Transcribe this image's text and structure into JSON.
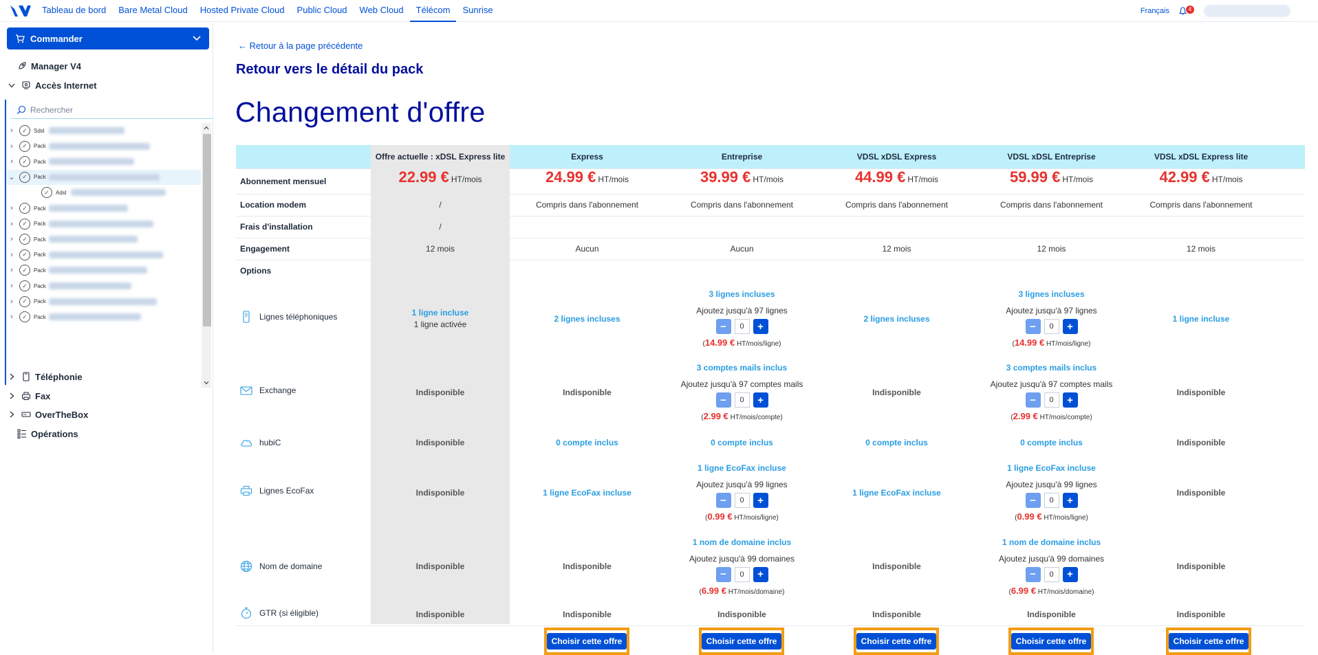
{
  "topnav": {
    "links": [
      "Tableau de bord",
      "Bare Metal Cloud",
      "Hosted Private Cloud",
      "Public Cloud",
      "Web Cloud",
      "Télécom",
      "Sunrise"
    ],
    "active_index": 5,
    "language": "Français",
    "notifications": "4"
  },
  "sidebar": {
    "order_button": "Commander",
    "manager": "Manager V4",
    "internet": "Accès Internet",
    "search_placeholder": "Rechercher",
    "tree_items": [
      {
        "type": "Sdsl",
        "selected": false,
        "expanded": false,
        "level": 0
      },
      {
        "type": "Pack",
        "selected": false,
        "expanded": false,
        "level": 0
      },
      {
        "type": "Pack",
        "selected": false,
        "expanded": false,
        "level": 0
      },
      {
        "type": "Pack",
        "selected": true,
        "expanded": true,
        "level": 0
      },
      {
        "type": "Adsl",
        "selected": false,
        "expanded": false,
        "level": 1
      },
      {
        "type": "Pack",
        "selected": false,
        "expanded": false,
        "level": 0
      },
      {
        "type": "Pack",
        "selected": false,
        "expanded": false,
        "level": 0
      },
      {
        "type": "Pack",
        "selected": false,
        "expanded": false,
        "level": 0
      },
      {
        "type": "Pack",
        "selected": false,
        "expanded": false,
        "level": 0
      },
      {
        "type": "Pack",
        "selected": false,
        "expanded": false,
        "level": 0
      },
      {
        "type": "Pack",
        "selected": false,
        "expanded": false,
        "level": 0
      },
      {
        "type": "Pack",
        "selected": false,
        "expanded": false,
        "level": 0
      },
      {
        "type": "Pack",
        "selected": false,
        "expanded": false,
        "level": 0
      }
    ],
    "sections": [
      "Téléphonie",
      "Fax",
      "OverTheBox",
      "Opérations"
    ]
  },
  "main": {
    "back_link": "← Retour à la page précédente",
    "pack_title": "Retour vers le détail du pack",
    "page_title": "Changement d'offre",
    "row_labels": [
      "Abonnement mensuel",
      "Location modem",
      "Frais d'installation",
      "Engagement",
      "Options"
    ],
    "offers": [
      {
        "name": "Offre actuelle : xDSL Express lite",
        "price": "22.99 €",
        "unit": "HT/mois",
        "modem": "/",
        "install": "/",
        "engagement": "12 mois"
      },
      {
        "name": "Express",
        "price": "24.99 €",
        "unit": "HT/mois",
        "modem": "Compris dans l'abonnement",
        "install": "",
        "engagement": "Aucun"
      },
      {
        "name": "Entreprise",
        "price": "39.99 €",
        "unit": "HT/mois",
        "modem": "Compris dans l'abonnement",
        "install": "",
        "engagement": "Aucun"
      },
      {
        "name": "VDSL xDSL Express",
        "price": "44.99 €",
        "unit": "HT/mois",
        "modem": "Compris dans l'abonnement",
        "install": "",
        "engagement": "12 mois"
      },
      {
        "name": "VDSL xDSL Entreprise",
        "price": "59.99 €",
        "unit": "HT/mois",
        "modem": "Compris dans l'abonnement",
        "install": "",
        "engagement": "12 mois"
      },
      {
        "name": "VDSL xDSL Express lite",
        "price": "42.99 €",
        "unit": "HT/mois",
        "modem": "Compris dans l'abonnement",
        "install": "",
        "engagement": "12 mois"
      }
    ],
    "options": {
      "lines": {
        "label": "Lignes téléphoniques",
        "current_top": "1 ligne incluse",
        "current_sub": "1 ligne activée",
        "express": "2 lignes incluses",
        "ent_included": "3 lignes incluses",
        "ent_add": "Ajoutez jusqu'à 97 lignes",
        "ent_price": "14.99 €",
        "ent_unit": "HT/mois/ligne",
        "vdsl_express": "2 lignes incluses",
        "vdsl_ent_included": "3 lignes incluses",
        "vdsl_ent_add": "Ajoutez jusqu'à 97 lignes",
        "vdsl_ent_price": "14.99 €",
        "vdsl_ent_unit": "HT/mois/ligne",
        "vdsl_lite": "1 ligne incluse",
        "value": "0"
      },
      "exchange": {
        "label": "Exchange",
        "current": "Indisponible",
        "express": "Indisponible",
        "ent_included": "3 comptes mails inclus",
        "ent_add": "Ajoutez jusqu'à 97 comptes mails",
        "ent_price": "2.99 €",
        "ent_unit": "HT/mois/compte",
        "vdsl_express": "Indisponible",
        "vdsl_ent_included": "3 comptes mails inclus",
        "vdsl_ent_add": "Ajoutez jusqu'à 97 comptes mails",
        "vdsl_ent_price": "2.99 €",
        "vdsl_ent_unit": "HT/mois/compte",
        "vdsl_lite": "Indisponible",
        "value": "0"
      },
      "hubic": {
        "label": "hubiC",
        "current": "Indisponible",
        "express": "0 compte inclus",
        "ent": "0 compte inclus",
        "vdsl_express": "0 compte inclus",
        "vdsl_ent": "0 compte inclus",
        "vdsl_lite": "Indisponible"
      },
      "ecofax": {
        "label": "Lignes EcoFax",
        "current": "Indisponible",
        "express": "1 ligne EcoFax incluse",
        "ent_included": "1 ligne EcoFax incluse",
        "ent_add": "Ajoutez jusqu'à 99 lignes",
        "ent_price": "0.99 €",
        "ent_unit": "HT/mois/ligne",
        "vdsl_express": "1 ligne EcoFax incluse",
        "vdsl_ent_included": "1 ligne EcoFax incluse",
        "vdsl_ent_add": "Ajoutez jusqu'à 99 lignes",
        "vdsl_ent_price": "0.99 €",
        "vdsl_ent_unit": "HT/mois/ligne",
        "vdsl_lite": "Indisponible",
        "value": "0"
      },
      "domain": {
        "label": "Nom de domaine",
        "current": "Indisponible",
        "express": "Indisponible",
        "ent_included": "1 nom de domaine inclus",
        "ent_add": "Ajoutez jusqu'à 99 domaines",
        "ent_price": "6.99 €",
        "ent_unit": "HT/mois/domaine",
        "vdsl_express": "Indisponible",
        "vdsl_ent_included": "1 nom de domaine inclus",
        "vdsl_ent_add": "Ajoutez jusqu'à 99 domaines",
        "vdsl_ent_price": "6.99 €",
        "vdsl_ent_unit": "HT/mois/domaine",
        "vdsl_lite": "Indisponible",
        "value": "0"
      },
      "gtr": {
        "label": "GTR (si éligible)",
        "values": [
          "Indisponible",
          "Indisponible",
          "Indisponible",
          "Indisponible",
          "Indisponible",
          "Indisponible"
        ]
      }
    },
    "choose_label": "Choisir cette offre",
    "colors": {
      "brand": "#0050d7",
      "title": "#000e9c",
      "price": "#e8312d",
      "included": "#2a9de2",
      "header_band": "#bdf0fb",
      "current_col": "#e8e8e8",
      "highlight": "#f39c12"
    }
  }
}
